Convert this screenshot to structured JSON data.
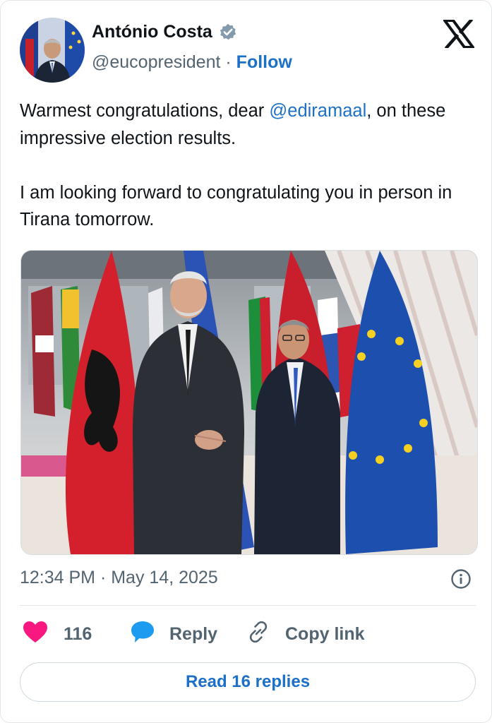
{
  "author": {
    "name": "António Costa",
    "handle": "@eucopresident",
    "separator": "·",
    "follow_label": "Follow",
    "verified": true
  },
  "tweet": {
    "line1_before": "Warmest congratulations, dear ",
    "mention": "@ediramaal",
    "line1_after": ", on these impressive election results.",
    "paragraph2": "I am looking forward to congratulating you in person in Tirana tomorrow."
  },
  "timestamp": "12:34 PM · May 14, 2025",
  "actions": {
    "like_count": "116",
    "reply_label": "Reply",
    "copy_link_label": "Copy link"
  },
  "read_replies_label": "Read 16 replies",
  "icons": {
    "platform": "x-logo-icon",
    "verified": "verified-badge-icon",
    "info": "info-icon",
    "like": "heart-icon",
    "reply": "speech-bubble-icon",
    "copy": "link-icon"
  },
  "colors": {
    "accent": "#1d70c8",
    "heart": "#f91880",
    "reply_bubble": "#1d9bf0",
    "muted": "#536471"
  }
}
